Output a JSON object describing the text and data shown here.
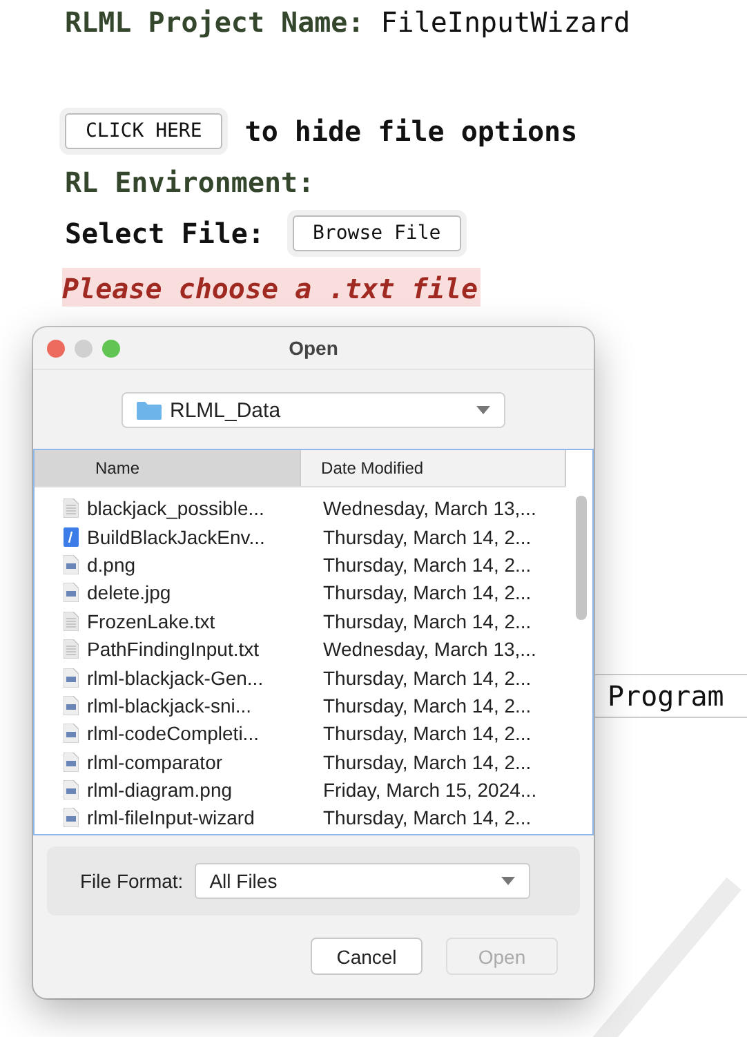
{
  "project": {
    "label": "RLML Project Name:",
    "value": "FileInputWizard"
  },
  "toggle": {
    "button": "CLICK HERE",
    "text": "to hide file options"
  },
  "environment_label": "RL Environment:",
  "select_file": {
    "label": "Select File:",
    "button": "Browse File"
  },
  "error": "Please choose a .txt file",
  "background_field": {
    "value": "Program"
  },
  "dialog": {
    "title": "Open",
    "folder": "RLML_Data",
    "columns": [
      "Name",
      "Date Modified"
    ],
    "files": [
      {
        "name": "blackjack_possible...",
        "date": "Wednesday, March 13,...",
        "kind": "text",
        "selected": false
      },
      {
        "name": "BuildBlackJackEnv...",
        "date": "Thursday, March 14, 2...",
        "kind": "script",
        "selected": false
      },
      {
        "name": "d.png",
        "date": "Thursday, March 14, 2...",
        "kind": "image",
        "selected": false
      },
      {
        "name": "delete.jpg",
        "date": "Thursday, March 14, 2...",
        "kind": "image",
        "selected": false
      },
      {
        "name": "FrozenLake.txt",
        "date": "Thursday, March 14, 2...",
        "kind": "text",
        "selected": false
      },
      {
        "name": "PathFindingInput.txt",
        "date": "Wednesday, March 13,...",
        "kind": "text",
        "selected": false
      },
      {
        "name": "rlml-blackjack-Gen...",
        "date": "Thursday, March 14, 2...",
        "kind": "image",
        "selected": false
      },
      {
        "name": "rlml-blackjack-sni...",
        "date": "Thursday, March 14, 2...",
        "kind": "image",
        "selected": false
      },
      {
        "name": "rlml-codeCompleti...",
        "date": "Thursday, March 14, 2...",
        "kind": "image",
        "selected": false
      },
      {
        "name": "rlml-comparator",
        "date": "Thursday, March 14, 2...",
        "kind": "image",
        "selected": false
      },
      {
        "name": "rlml-diagram.png",
        "date": "Friday, March 15, 2024...",
        "kind": "image",
        "selected": false
      },
      {
        "name": "rlml-fileInput-wizard",
        "date": "Thursday, March 14, 2...",
        "kind": "image",
        "selected": false
      }
    ],
    "format": {
      "label": "File Format:",
      "value": "All Files"
    },
    "buttons": [
      {
        "label": "Cancel",
        "disabled": false
      },
      {
        "label": "Open",
        "disabled": true
      }
    ]
  }
}
